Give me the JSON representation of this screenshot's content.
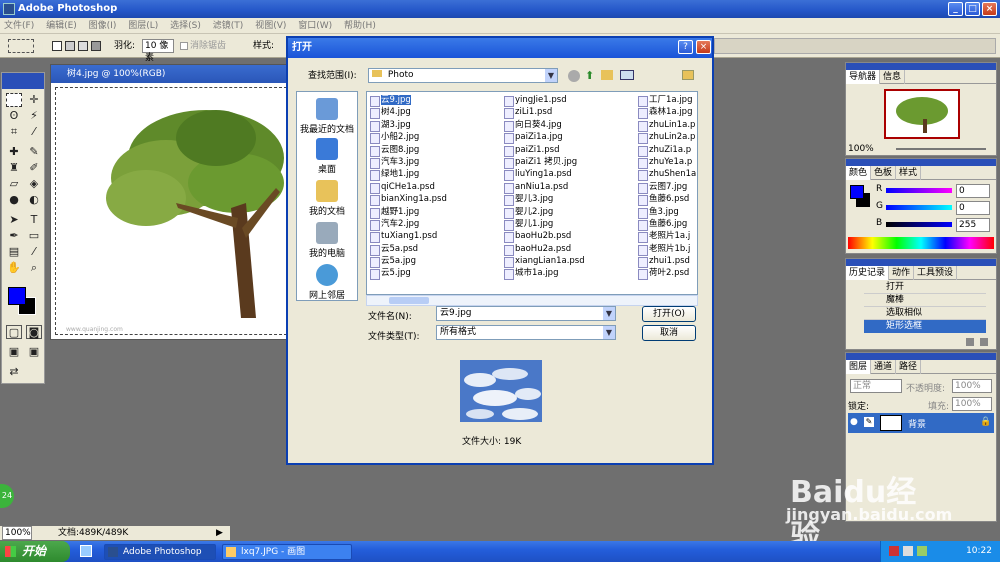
{
  "app": {
    "title": "Adobe Photoshop"
  },
  "menu": [
    "文件(F)",
    "编辑(E)",
    "图像(I)",
    "图层(L)",
    "选择(S)",
    "滤镜(T)",
    "视图(V)",
    "窗口(W)",
    "帮助(H)"
  ],
  "options": {
    "feather_label": "羽化:",
    "feather_value": "10 像素",
    "antialias_label": "消除锯齿",
    "style_label": "样式:"
  },
  "document": {
    "title": "树4.jpg @ 100%(RGB)",
    "status_zoom": "100%",
    "status_doc": "文档:489K/489K",
    "watermark": "www.quanjing.com"
  },
  "dialog": {
    "title": "打开",
    "lookin_label": "查找范围(I):",
    "lookin_value": "Photo",
    "places": [
      "我最近的文档",
      "桌面",
      "我的文档",
      "我的电脑",
      "网上邻居"
    ],
    "files_col1": [
      "云9.jpg",
      "树4.jpg",
      "湖3.jpg",
      "小船2.jpg",
      "云图8.jpg",
      "汽车3.jpg",
      "绿地1.jpg",
      "qiCHe1a.psd",
      "bianXing1a.psd",
      "越野1.jpg",
      "汽车2.jpg",
      "tuXiang1.psd",
      "云5a.psd",
      "云5a.jpg",
      "云5.jpg"
    ],
    "files_col2": [
      "yingJie1.psd",
      "ziLi1.psd",
      "向日葵4.jpg",
      "paiZi1a.jpg",
      "paiZi1.psd",
      "paiZi1 拷贝.jpg",
      "liuYing1a.psd",
      "anNiu1a.psd",
      "婴儿3.jpg",
      "婴儿2.jpg",
      "婴儿1.jpg",
      "baoHu2b.psd",
      "baoHu2a.psd",
      "xiangLian1a.psd",
      "城市1a.jpg"
    ],
    "files_col3": [
      "工厂1a.jpg",
      "森林1a.jpg",
      "zhuLin1a.p",
      "zhuLin2a.p",
      "zhuZi1a.p",
      "zhuYe1a.p",
      "zhuShen1a.",
      "云图7.jpg",
      "鱼藤6.psd",
      "鱼3.jpg",
      "鱼藤6.jpg",
      "老照片1a.j",
      "老照片1b.j",
      "zhui1.psd",
      "荷叶2.psd"
    ],
    "filename_label": "文件名(N):",
    "filename_value": "云9.jpg",
    "filetype_label": "文件类型(T):",
    "filetype_value": "所有格式",
    "open_button": "打开(O)",
    "cancel_button": "取消",
    "filesize": "文件大小: 19K"
  },
  "panels": {
    "navigator_tabs": [
      "导航器",
      "信息"
    ],
    "navigator_zoom": "100%",
    "color_tabs": [
      "颜色",
      "色板",
      "样式"
    ],
    "color_values": {
      "R": "0",
      "G": "0",
      "B": "255"
    },
    "history_tabs": [
      "历史记录",
      "动作",
      "工具预设"
    ],
    "history_items": [
      "打开",
      "魔棒",
      "选取相似",
      "矩形选框"
    ],
    "layers_tabs": [
      "图层",
      "通道",
      "路径"
    ],
    "layers_mode": "正常",
    "layers_opacity_label": "不透明度:",
    "layers_opacity": "100%",
    "layers_lock_label": "锁定:",
    "layers_fill_label": "填充:",
    "layers_fill": "100%",
    "layer_name": "背景"
  },
  "taskbar": {
    "start": "开始",
    "tasks": [
      "Adobe Photoshop",
      "lxq7.JPG - 画图"
    ],
    "clock": "10:22"
  },
  "overlay": {
    "badge": "24",
    "baidu_logo": "Baidu经验",
    "baidu_url": "jingyan.baidu.com"
  },
  "colors": {
    "accent": "#2456c8",
    "selection": "#316ac5",
    "foreground_swatch": "#0000ff",
    "taskbar": "#245edb"
  }
}
